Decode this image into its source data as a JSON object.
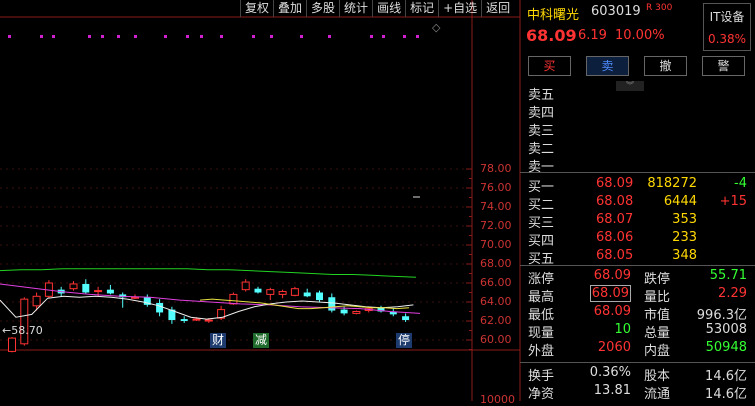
{
  "toolbar": [
    {
      "label": "复权"
    },
    {
      "label": "叠加"
    },
    {
      "label": "多股"
    },
    {
      "label": "统计"
    },
    {
      "label": "画线"
    },
    {
      "label": "标记"
    },
    {
      "label": "+自选"
    },
    {
      "label": "返回"
    }
  ],
  "kline": {
    "y_ticks": [
      "78.00",
      "76.00",
      "74.00",
      "72.00",
      "70.00",
      "68.00",
      "66.00",
      "64.00",
      "62.00",
      "60.00"
    ],
    "low_label": "←58.70",
    "events": [
      {
        "label": "财",
        "color": "#1d3b6e"
      },
      {
        "label": "减",
        "color": "#1f6b2b"
      },
      {
        "label": "停",
        "color": "#1d3b6e"
      }
    ],
    "volume_label": "10000"
  },
  "chart_data": {
    "type": "candlestick",
    "ylim": [
      58.5,
      79.5
    ],
    "y_ticks": [
      60,
      62,
      64,
      66,
      68,
      70,
      72,
      74,
      76,
      78
    ],
    "candles": [
      {
        "o": 58.8,
        "h": 60.3,
        "l": 58.7,
        "c": 60.2
      },
      {
        "o": 59.6,
        "h": 64.5,
        "l": 59.4,
        "c": 64.3
      },
      {
        "o": 63.6,
        "h": 65.0,
        "l": 63.1,
        "c": 64.6
      },
      {
        "o": 64.6,
        "h": 66.3,
        "l": 64.4,
        "c": 66.0
      },
      {
        "o": 65.3,
        "h": 65.6,
        "l": 64.6,
        "c": 64.9
      },
      {
        "o": 65.4,
        "h": 66.2,
        "l": 65.2,
        "c": 65.9
      },
      {
        "o": 65.9,
        "h": 66.4,
        "l": 64.9,
        "c": 65.0
      },
      {
        "o": 65.1,
        "h": 65.6,
        "l": 64.6,
        "c": 65.2
      },
      {
        "o": 65.3,
        "h": 65.8,
        "l": 64.8,
        "c": 64.9
      },
      {
        "o": 64.8,
        "h": 65.0,
        "l": 63.4,
        "c": 64.5
      },
      {
        "o": 64.4,
        "h": 64.8,
        "l": 64.3,
        "c": 64.5
      },
      {
        "o": 64.5,
        "h": 64.8,
        "l": 63.5,
        "c": 63.7
      },
      {
        "o": 63.9,
        "h": 64.3,
        "l": 62.5,
        "c": 62.9
      },
      {
        "o": 63.2,
        "h": 63.5,
        "l": 61.7,
        "c": 62.1
      },
      {
        "o": 62.2,
        "h": 62.5,
        "l": 61.8,
        "c": 62.0
      },
      {
        "o": 62.1,
        "h": 62.4,
        "l": 62.0,
        "c": 62.2
      },
      {
        "o": 62.1,
        "h": 62.3,
        "l": 61.8,
        "c": 62.1
      },
      {
        "o": 62.3,
        "h": 63.6,
        "l": 62.1,
        "c": 63.2
      },
      {
        "o": 63.8,
        "h": 65.0,
        "l": 63.7,
        "c": 64.8
      },
      {
        "o": 65.3,
        "h": 66.4,
        "l": 65.1,
        "c": 66.1
      },
      {
        "o": 65.4,
        "h": 65.6,
        "l": 64.9,
        "c": 65.0
      },
      {
        "o": 64.8,
        "h": 65.5,
        "l": 64.2,
        "c": 65.3
      },
      {
        "o": 64.8,
        "h": 65.3,
        "l": 64.4,
        "c": 65.1
      },
      {
        "o": 64.7,
        "h": 65.6,
        "l": 64.6,
        "c": 65.4
      },
      {
        "o": 65.0,
        "h": 65.4,
        "l": 64.5,
        "c": 64.6
      },
      {
        "o": 65.0,
        "h": 65.2,
        "l": 64.0,
        "c": 64.2
      },
      {
        "o": 64.5,
        "h": 64.9,
        "l": 62.9,
        "c": 63.1
      },
      {
        "o": 63.2,
        "h": 63.5,
        "l": 62.6,
        "c": 62.8
      },
      {
        "o": 62.8,
        "h": 63.1,
        "l": 62.7,
        "c": 63.0
      },
      {
        "o": 63.1,
        "h": 63.4,
        "l": 62.9,
        "c": 63.3
      },
      {
        "o": 63.4,
        "h": 63.6,
        "l": 62.9,
        "c": 63.0
      },
      {
        "o": 63.0,
        "h": 63.3,
        "l": 62.5,
        "c": 62.7
      },
      {
        "o": 62.5,
        "h": 62.8,
        "l": 61.9,
        "c": 62.1
      }
    ],
    "ma_green": [
      67.3,
      67.4,
      67.4,
      67.5,
      67.5,
      67.5,
      67.5,
      67.5,
      67.5,
      67.5,
      67.4,
      67.4,
      67.3,
      67.2,
      67.1,
      67.0,
      66.9,
      66.9,
      66.8,
      66.7,
      66.6
    ],
    "ma_magenta": [
      65.9,
      65.5,
      65.1,
      64.8,
      64.6,
      64.5,
      64.2,
      64.0,
      63.8,
      63.7,
      63.5,
      63.4,
      63.3,
      63.0,
      62.8
    ],
    "ma_white": [
      64.2,
      62.4,
      62.7,
      64.4,
      64.6,
      64.5,
      64.6,
      64.5,
      64.3,
      64.0,
      63.6,
      63.0,
      62.4,
      62.2,
      62.4,
      63.0,
      63.5,
      63.8,
      64.0,
      64.1,
      64.0,
      63.9,
      63.7,
      63.5,
      63.4,
      63.5,
      63.7
    ],
    "ma_yellow": [
      64.2,
      64.3,
      64.2,
      64.1,
      64.0,
      63.9,
      63.7,
      63.5,
      63.3,
      63.3,
      63.4,
      63.5,
      63.6,
      63.5,
      63.4,
      63.4,
      63.3,
      63.4
    ]
  },
  "quote": {
    "name": "中科曙光",
    "code": "603019",
    "r_mark": "R 300",
    "sector_name": "IT设备",
    "sector_pct": "0.38%",
    "price": "68.09",
    "change": "6.19",
    "change_pct": "10.00%"
  },
  "trade_buttons": [
    {
      "label": "买",
      "color": "#ff3333"
    },
    {
      "label": "卖",
      "color": "#4f8cff"
    },
    {
      "label": "撤",
      "color": "#ddd"
    },
    {
      "label": "警",
      "color": "#ddd"
    }
  ],
  "collapse_tab": "︾",
  "sells": [
    {
      "label": "卖五",
      "price": "",
      "vol": "",
      "chg": ""
    },
    {
      "label": "卖四",
      "price": "",
      "vol": "",
      "chg": ""
    },
    {
      "label": "卖三",
      "price": "",
      "vol": "",
      "chg": ""
    },
    {
      "label": "卖二",
      "price": "",
      "vol": "",
      "chg": ""
    },
    {
      "label": "卖一",
      "price": "",
      "vol": "",
      "chg": ""
    }
  ],
  "buys": [
    {
      "label": "买一",
      "price": "68.09",
      "vol": "818272",
      "chg": "-4",
      "chg_color": "#33ff33"
    },
    {
      "label": "买二",
      "price": "68.08",
      "vol": "6444",
      "chg": "+15",
      "chg_color": "#ff3333"
    },
    {
      "label": "买三",
      "price": "68.07",
      "vol": "353",
      "chg": "",
      "chg_color": "#ddd"
    },
    {
      "label": "买四",
      "price": "68.06",
      "vol": "233",
      "chg": "",
      "chg_color": "#ddd"
    },
    {
      "label": "买五",
      "price": "68.05",
      "vol": "348",
      "chg": "",
      "chg_color": "#ddd"
    }
  ],
  "stats": [
    {
      "l1": "涨停",
      "v1": "68.09",
      "c1": "#ff3333",
      "l2": "跌停",
      "v2": "55.71",
      "c2": "#33ff33"
    },
    {
      "l1": "最高",
      "v1": "68.09",
      "c1": "#ff3333",
      "l2": "量比",
      "v2": "2.29",
      "c2": "#ff3333",
      "box1": true
    },
    {
      "l1": "最低",
      "v1": "68.09",
      "c1": "#ff3333",
      "l2": "市值",
      "v2": "996.3亿",
      "c2": "#ddd"
    },
    {
      "l1": "现量",
      "v1": "10",
      "c1": "#33ff33",
      "l2": "总量",
      "v2": "53008",
      "c2": "#ddd"
    },
    {
      "l1": "外盘",
      "v1": "2060",
      "c1": "#ff3333",
      "l2": "内盘",
      "v2": "50948",
      "c2": "#33ff33"
    }
  ],
  "fin": [
    {
      "l1": "换手",
      "v1": "0.36%",
      "l2": "股本",
      "v2": "14.6亿"
    },
    {
      "l1": "净资",
      "v1": "13.81",
      "l2": "流通",
      "v2": "14.6亿"
    }
  ]
}
